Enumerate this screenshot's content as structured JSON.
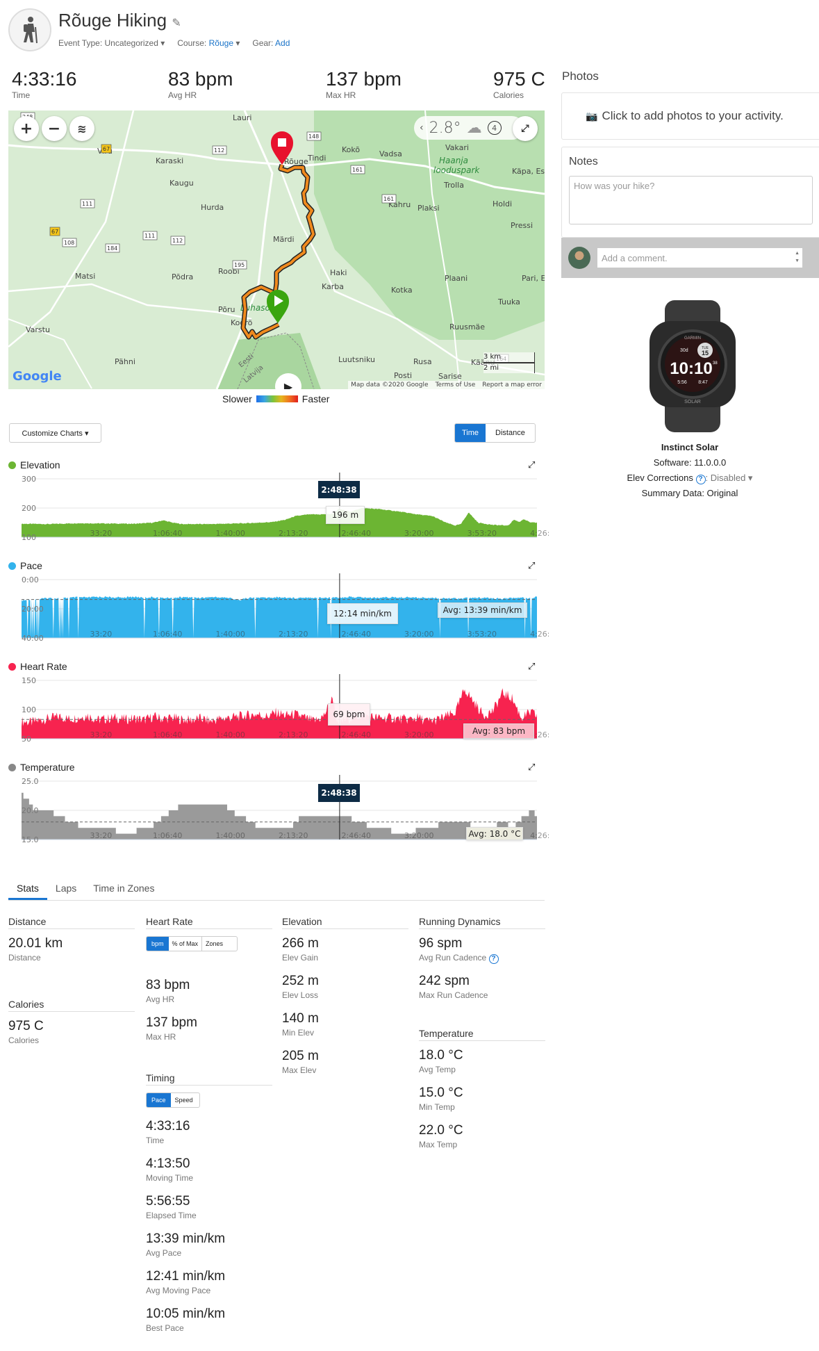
{
  "header": {
    "title": "Rõuge Hiking",
    "event_type_label": "Event Type:",
    "event_type": "Uncategorized",
    "course_label": "Course:",
    "course": "Rõuge",
    "gear_label": "Gear:",
    "gear": "Add",
    "activity_icon": "hiker-icon"
  },
  "summary": [
    {
      "value": "4:33:16",
      "label": "Time"
    },
    {
      "value": "83 bpm",
      "label": "Avg HR"
    },
    {
      "value": "137 bpm",
      "label": "Max HR"
    },
    {
      "value": "975 C",
      "label": "Calories"
    }
  ],
  "map": {
    "weather": {
      "temp": "2.8°",
      "icon": "cloud-icon",
      "wind": "4"
    },
    "places": [
      "Lauri",
      "Viru",
      "Karaski",
      "Kaugu",
      "Hurda",
      "Märdi",
      "Roobi",
      "Põdra",
      "Matsi",
      "Varstu",
      "Pähni",
      "Kokõ",
      "Vadsa",
      "Vakari",
      "Trolla",
      "Käpa, Estonia",
      "Kahru",
      "Plaksi",
      "Holdi",
      "Pressi",
      "Plaani",
      "Pari, Estonia",
      "Haki",
      "Karba",
      "Kotka",
      "Tuuka",
      "Ruusmäe",
      "Luutsniku",
      "Rusa",
      "Posti",
      "Sarise",
      "Käänu",
      "Tindi",
      "Rõuge",
      "Põru",
      "Kogrõ"
    ],
    "park": [
      "Haanja",
      "looduspark",
      "Luhasoo"
    ],
    "roads": [
      "248",
      "67",
      "112",
      "111",
      "67",
      "108",
      "184",
      "111",
      "112",
      "195",
      "148",
      "161",
      "161",
      "164"
    ],
    "border": [
      "Eesti",
      "Latvija"
    ],
    "scale": [
      "3 km",
      "2 mi"
    ],
    "attribution": "Map data ©2020 Google",
    "terms": "Terms of Use",
    "report": "Report a map error",
    "logo": "Google"
  },
  "legend": {
    "slower": "Slower",
    "faster": "Faster"
  },
  "controls": {
    "customize": "Customize Charts ▾",
    "time": "Time",
    "distance": "Distance",
    "active": "Time"
  },
  "chart_data": [
    {
      "type": "area",
      "title": "Elevation",
      "color": "#6cb533",
      "ylim": [
        100,
        300
      ],
      "yticks": [
        "100",
        "200",
        "300"
      ],
      "xlim": [
        "0:00:00",
        "4:33:16"
      ],
      "xticks": [
        "33:20",
        "1:06:40",
        "1:40:00",
        "2:13:20",
        "2:46:40",
        "3:20:00",
        "3:53:20",
        "4:26:40"
      ],
      "x": [
        "0:00",
        "0:15",
        "0:30",
        "0:45",
        "1:00",
        "1:10",
        "1:15",
        "1:20",
        "1:25",
        "1:40",
        "2:00",
        "2:13",
        "2:20",
        "2:25",
        "2:32",
        "2:38",
        "2:45",
        "2:48",
        "2:55",
        "3:00",
        "3:10",
        "3:20",
        "3:30",
        "3:38",
        "3:45",
        "3:50",
        "3:53",
        "3:57",
        "4:02",
        "4:10",
        "4:18",
        "4:21",
        "4:24",
        "4:26",
        "4:30",
        "4:33"
      ],
      "values": [
        146,
        145,
        148,
        147,
        146,
        150,
        158,
        150,
        145,
        145,
        148,
        152,
        160,
        172,
        178,
        178,
        180,
        196,
        188,
        200,
        196,
        188,
        178,
        172,
        150,
        140,
        145,
        185,
        150,
        142,
        140,
        160,
        152,
        162,
        150,
        150
      ],
      "cursor": {
        "time": "2:48:38",
        "value": "196 m"
      }
    },
    {
      "type": "area",
      "title": "Pace",
      "color": "#33b3ec",
      "ylim": [
        "0:00",
        "40:00"
      ],
      "inverted": true,
      "yticks": [
        "0:00",
        "20:00",
        "40:00"
      ],
      "xlim": [
        "0:00:00",
        "4:33:16"
      ],
      "xticks": [
        "33:20",
        "1:06:40",
        "1:40:00",
        "2:13:20",
        "2:46:40",
        "3:20:00",
        "3:53:20",
        "4:26:40"
      ],
      "x": [
        "0:00",
        "0:05",
        "0:10",
        "0:15",
        "0:20",
        "0:25",
        "0:30",
        "0:35",
        "0:40",
        "0:45",
        "0:50",
        "0:55",
        "1:00",
        "1:05",
        "1:10",
        "1:15",
        "1:20",
        "1:25",
        "1:30",
        "1:35",
        "1:40",
        "1:45",
        "1:50",
        "1:55",
        "2:00",
        "2:05",
        "2:10",
        "2:15",
        "2:20",
        "2:25",
        "2:30",
        "2:35",
        "2:40",
        "2:45",
        "2:50",
        "2:55",
        "3:00",
        "3:05",
        "3:10",
        "3:15",
        "3:20",
        "3:25",
        "3:30",
        "3:35",
        "3:40",
        "3:45",
        "3:50",
        "3:55",
        "4:00",
        "4:05",
        "4:10",
        "4:15",
        "4:20",
        "4:25",
        "4:30",
        "4:33"
      ],
      "values": [
        "14:30",
        "13:40",
        "13:10",
        "12:40",
        "12:50",
        "12:30",
        "12:10",
        "12:20",
        "11:50",
        "12:00",
        "12:20",
        "12:10",
        "11:50",
        "12:20",
        "12:10",
        "12:40",
        "12:20",
        "12:10",
        "12:10",
        "12:30",
        "12:00",
        "12:10",
        "12:30",
        "14:00",
        "12:40",
        "12:20",
        "12:30",
        "12:10",
        "12:20",
        "12:40",
        "12:10",
        "12:20",
        "12:30",
        "12:20",
        "12:14",
        "12:00",
        "12:10",
        "12:30",
        "12:20",
        "12:10",
        "12:20",
        "12:00",
        "12:30",
        "12:20",
        "12:40",
        "12:40",
        "12:50",
        "12:40",
        "12:30",
        "12:40",
        "12:50",
        "13:00",
        "12:40",
        "12:30",
        "12:40",
        "11:40"
      ],
      "gaps": [
        "0:03",
        "0:05",
        "0:06",
        "0:07",
        "0:08",
        "0:09",
        "0:13",
        "0:17",
        "0:18",
        "0:20",
        "0:21",
        "0:22",
        "0:25",
        "0:30",
        "1:05",
        "1:13",
        "1:20",
        "1:31",
        "2:04",
        "2:05",
        "2:37",
        "2:44",
        "2:51",
        "3:42",
        "3:57",
        "4:18",
        "4:27",
        "4:30"
      ],
      "avg": "13:39",
      "avg_label": "Avg: 13:39 min/km",
      "cursor": {
        "time": "2:48:38",
        "value": "12:14 min/km"
      }
    },
    {
      "type": "area",
      "title": "Heart Rate",
      "color": "#f7234f",
      "ylim": [
        50,
        150
      ],
      "yticks": [
        "50",
        "100",
        "150"
      ],
      "xlim": [
        "0:00:00",
        "4:33:16"
      ],
      "xticks": [
        "33:20",
        "1:06:40",
        "1:40:00",
        "2:13:20",
        "2:46:40",
        "3:20:00",
        "3:53:20",
        "4:26:40"
      ],
      "x": [
        "0:00",
        "0:05",
        "0:10",
        "0:15",
        "0:20",
        "0:25",
        "0:30",
        "0:35",
        "0:40",
        "0:45",
        "0:50",
        "0:55",
        "1:00",
        "1:05",
        "1:10",
        "1:15",
        "1:20",
        "1:25",
        "1:30",
        "1:35",
        "1:40",
        "1:45",
        "1:50",
        "1:55",
        "2:00",
        "2:05",
        "2:10",
        "2:15",
        "2:20",
        "2:25",
        "2:30",
        "2:35",
        "2:40",
        "2:45",
        "2:48",
        "2:50",
        "2:55",
        "3:00",
        "3:05",
        "3:10",
        "3:15",
        "3:20",
        "3:25",
        "3:30",
        "3:35",
        "3:40",
        "3:45",
        "3:50",
        "3:55",
        "4:00",
        "4:05",
        "4:10",
        "4:15",
        "4:20",
        "4:25",
        "4:30",
        "4:33"
      ],
      "values": [
        80,
        78,
        82,
        85,
        88,
        84,
        86,
        90,
        82,
        84,
        86,
        83,
        85,
        82,
        88,
        84,
        86,
        83,
        82,
        85,
        80,
        84,
        86,
        88,
        90,
        92,
        88,
        95,
        90,
        92,
        86,
        80,
        88,
        120,
        69,
        80,
        86,
        90,
        88,
        85,
        86,
        84,
        83,
        86,
        80,
        82,
        88,
        95,
        135,
        112,
        90,
        98,
        128,
        120,
        86,
        95,
        90
      ],
      "avg": 83,
      "avg_label": "Avg: 83 bpm",
      "cursor": {
        "time": "2:48:38",
        "value": "69 bpm"
      }
    },
    {
      "type": "area",
      "title": "Temperature",
      "color": "#9a9a9a",
      "step": true,
      "ylim": [
        15,
        25
      ],
      "yticks": [
        "15.0",
        "20.0",
        "25.0"
      ],
      "xlim": [
        "0:00:00",
        "4:33:16"
      ],
      "xticks": [
        "33:20",
        "1:06:40",
        "1:40:00",
        "2:13:20",
        "2:46:40",
        "3:20:00",
        "3:53:20",
        "4:26:40"
      ],
      "x": [
        "0:00",
        "0:01",
        "0:04",
        "0:06",
        "0:17",
        "0:23",
        "0:30",
        "0:50",
        "1:01",
        "1:10",
        "1:14",
        "1:18",
        "1:23",
        "1:49",
        "1:53",
        "1:59",
        "2:04",
        "2:24",
        "2:27",
        "2:55",
        "3:03",
        "3:16",
        "3:29",
        "3:41",
        "3:58",
        "4:12",
        "4:18",
        "4:22",
        "4:25",
        "4:29",
        "4:32"
      ],
      "values": [
        23,
        22,
        21,
        20,
        19,
        18,
        17,
        16,
        17,
        18,
        19,
        20,
        21,
        20,
        19,
        18,
        17,
        18,
        19,
        18,
        17,
        16,
        17,
        18,
        17,
        18,
        17,
        18,
        19,
        20,
        19
      ],
      "avg": 18.0,
      "avg_label": "Avg: 18.0 °C",
      "cursor": {
        "time": "2:48:38"
      }
    }
  ],
  "tabs": [
    {
      "label": "Stats"
    },
    {
      "label": "Laps"
    },
    {
      "label": "Time in Zones"
    }
  ],
  "stats": {
    "distance": {
      "header": "Distance",
      "value": "20.01 km",
      "label": "Distance"
    },
    "calories": {
      "header": "Calories",
      "value": "975 C",
      "label": "Calories"
    },
    "heart_rate": {
      "header": "Heart Rate",
      "toggle": [
        "bpm",
        "% of Max",
        "Zones"
      ],
      "items": [
        {
          "value": "83 bpm",
          "label": "Avg HR"
        },
        {
          "value": "137 bpm",
          "label": "Max HR"
        }
      ]
    },
    "timing": {
      "header": "Timing",
      "toggle": [
        "Pace",
        "Speed"
      ],
      "items": [
        {
          "value": "4:33:16",
          "label": "Time"
        },
        {
          "value": "4:13:50",
          "label": "Moving Time"
        },
        {
          "value": "5:56:55",
          "label": "Elapsed Time"
        },
        {
          "value": "13:39 min/km",
          "label": "Avg Pace"
        },
        {
          "value": "12:41 min/km",
          "label": "Avg Moving Pace"
        },
        {
          "value": "10:05 min/km",
          "label": "Best Pace"
        }
      ]
    },
    "elevation": {
      "header": "Elevation",
      "items": [
        {
          "value": "266 m",
          "label": "Elev Gain"
        },
        {
          "value": "252 m",
          "label": "Elev Loss"
        },
        {
          "value": "140 m",
          "label": "Min Elev"
        },
        {
          "value": "205 m",
          "label": "Max Elev"
        }
      ]
    },
    "running": {
      "header": "Running Dynamics",
      "items": [
        {
          "value": "96 spm",
          "label": "Avg Run Cadence"
        },
        {
          "value": "242 spm",
          "label": "Max Run Cadence"
        }
      ]
    },
    "temperature": {
      "header": "Temperature",
      "items": [
        {
          "value": "18.0 °C",
          "label": "Avg Temp"
        },
        {
          "value": "15.0 °C",
          "label": "Min Temp"
        },
        {
          "value": "22.0 °C",
          "label": "Max Temp"
        }
      ]
    }
  },
  "sidebar": {
    "photos_title": "Photos",
    "photos_cta": "Click to add photos to your activity.",
    "notes_title": "Notes",
    "notes_placeholder": "How was your hike?",
    "comment_placeholder": "Add a comment.",
    "device": {
      "name": "Instinct Solar",
      "software": "Software: 11.0.0.0",
      "elev_label": "Elev Corrections",
      "elev_value": ": Disabled ▾",
      "summary": "Summary Data: Original",
      "watch_text": {
        "brand": "GARMIN",
        "time": "10:10",
        "seconds": "38",
        "day": "TUE",
        "date": "15",
        "battery": "30d",
        "sunrise": "5:56",
        "sunset": "8:47",
        "model": "SOLAR"
      }
    }
  }
}
